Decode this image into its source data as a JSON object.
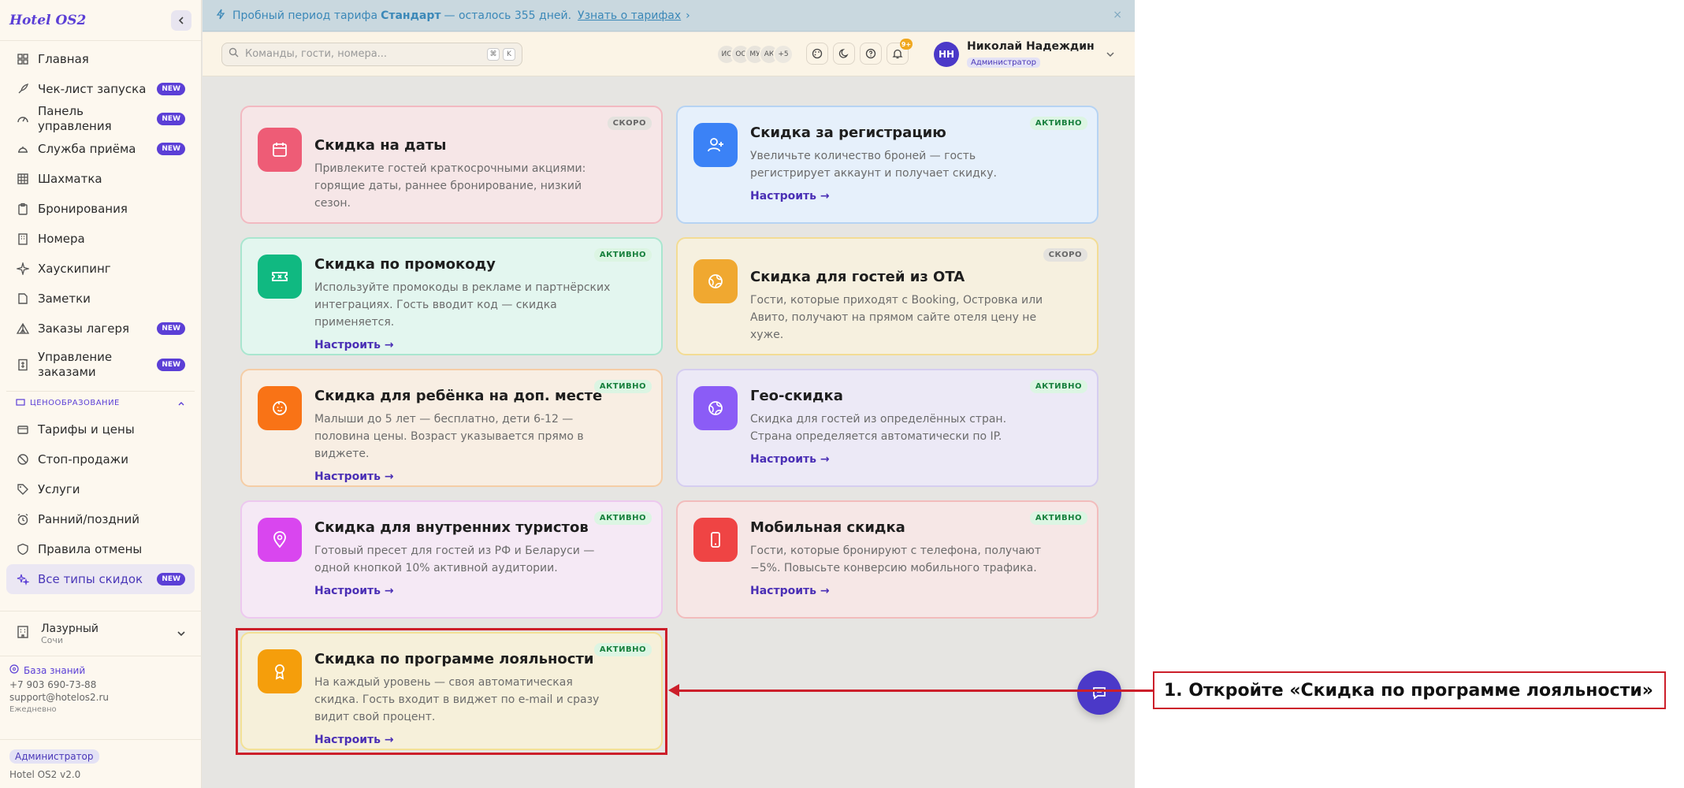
{
  "app": {
    "logo": "Hotel OS2"
  },
  "sidebar": {
    "items": [
      {
        "label": "Главная",
        "icon": "grid-icon"
      },
      {
        "label": "Чек-лист запуска",
        "icon": "rocket-icon",
        "badge": "NEW"
      },
      {
        "label": "Панель управления",
        "icon": "gauge-icon",
        "badge": "NEW"
      },
      {
        "label": "Служба приёма",
        "icon": "bell-desk-icon",
        "badge": "NEW"
      },
      {
        "label": "Шахматка",
        "icon": "table-icon"
      },
      {
        "label": "Бронирования",
        "icon": "clipboard-icon"
      },
      {
        "label": "Номера",
        "icon": "building-icon"
      },
      {
        "label": "Хаускипинг",
        "icon": "sparkle-icon"
      },
      {
        "label": "Заметки",
        "icon": "note-icon"
      },
      {
        "label": "Заказы лагеря",
        "icon": "tent-icon",
        "badge": "NEW"
      },
      {
        "label": "Управление заказами",
        "icon": "receipt-icon",
        "badge": "NEW"
      }
    ],
    "pricing_section": "ЦЕНООБРАЗОВАНИЕ",
    "pricing_items": [
      {
        "label": "Тарифы и цены",
        "icon": "wallet-icon"
      },
      {
        "label": "Стоп-продажи",
        "icon": "ban-icon"
      },
      {
        "label": "Услуги",
        "icon": "tag-icon"
      },
      {
        "label": "Ранний/поздний",
        "icon": "alarm-icon"
      },
      {
        "label": "Правила отмены",
        "icon": "shield-icon"
      },
      {
        "label": "Все типы скидок",
        "icon": "sparkles-icon",
        "badge": "NEW",
        "active": true
      }
    ],
    "hotel": {
      "name": "Лазурный",
      "city": "Сочи"
    },
    "footer": {
      "kb_label": "База знаний",
      "phone": "+7 903 690-73-88",
      "email": "support@hotelos2.ru",
      "hours": "Ежедневно",
      "role": "Администратор",
      "version": "Hotel OS2 v2.0"
    }
  },
  "banner": {
    "text_before": "Пробный период тарифа",
    "plan": "Стандарт",
    "text_after": "— осталось 355 дней.",
    "link": "Узнать о тарифах",
    "chevron": "›",
    "close": "×"
  },
  "header": {
    "search_placeholder": "Команды, гости, номера...",
    "kbd1": "⌘",
    "kbd2": "K",
    "avatars": [
      "ИС",
      "ОС",
      "МУ",
      "АК",
      "+5"
    ],
    "notif_count": "9+",
    "user_initials": "НН",
    "user_name": "Николай Надеждин",
    "user_role": "Администратор"
  },
  "cards": [
    {
      "title": "Скидка на даты",
      "desc": "Привлеките гостей краткосрочными акциями: горящие даты, раннее бронирование, низкий сезон.",
      "status": "СКОРО",
      "link": "",
      "icon": "calendar-icon",
      "bg": "#f6e6e7",
      "border": "#f2b9c1",
      "icon_bg": "#ee5c76"
    },
    {
      "title": "Скидка за регистрацию",
      "desc": "Увеличьте количество броней — гость регистрирует аккаунт и получает скидку.",
      "status": "АКТИВНО",
      "link": "Настроить →",
      "icon": "user-plus-icon",
      "bg": "#e6f0fb",
      "border": "#b6d3f3",
      "icon_bg": "#3b82f6"
    },
    {
      "title": "Скидка по промокоду",
      "desc": "Используйте промокоды в рекламе и партнёрских интеграциях. Гость вводит код — скидка применяется.",
      "status": "АКТИВНО",
      "link": "Настроить →",
      "icon": "ticket-icon",
      "bg": "#e3f6ef",
      "border": "#a9e6cf",
      "icon_bg": "#10b981"
    },
    {
      "title": "Скидка для гостей из OTA",
      "desc": "Гости, которые приходят с Booking, Островка или Авито, получают на прямом сайте отеля цену не хуже.",
      "status": "СКОРО",
      "link": "",
      "icon": "globe-icon",
      "bg": "#f6f0df",
      "border": "#f3dc94",
      "icon_bg": "#f0a830"
    },
    {
      "title": "Скидка для ребёнка на доп. месте",
      "desc": "Малыши до 5 лет — бесплатно, дети 6-12 — половина цены. Возраст указывается прямо в виджете.",
      "status": "АКТИВНО",
      "link": "Настроить →",
      "icon": "baby-icon",
      "bg": "#f8eee3",
      "border": "#f5cda6",
      "icon_bg": "#f97316"
    },
    {
      "title": "Гео-скидка",
      "desc": "Скидка для гостей из определённых стран. Страна определяется автоматически по IP.",
      "status": "АКТИВНО",
      "link": "Настроить →",
      "icon": "globe-icon",
      "bg": "#ece9f6",
      "border": "#d5cdf0",
      "icon_bg": "#8b5cf6"
    },
    {
      "title": "Скидка для внутренних туристов",
      "desc": "Готовый пресет для гостей из РФ и Беларуси — одной кнопкой 10% активной аудитории.",
      "status": "АКТИВНО",
      "link": "Настроить →",
      "icon": "map-pin-icon",
      "bg": "#f5e9f5",
      "border": "#edc8ef",
      "icon_bg": "#d946ef"
    },
    {
      "title": "Мобильная скидка",
      "desc": "Гости, которые бронируют с телефона, получают −5%. Повысьте конверсию мобильного трафика.",
      "status": "АКТИВНО",
      "link": "Настроить →",
      "icon": "smartphone-icon",
      "bg": "#f6e7e6",
      "border": "#f2bcbc",
      "icon_bg": "#ef4444"
    },
    {
      "title": "Скидка по программе лояльности",
      "desc": "На каждый уровень — своя автоматическая скидка. Гость входит в виджет по e-mail и сразу видит свой процент.",
      "status": "АКТИВНО",
      "link": "Настроить →",
      "icon": "award-icon",
      "bg": "#f6f0da",
      "border": "#f3e196",
      "icon_bg": "#f59e0b"
    }
  ],
  "annotation": {
    "text": "1. Откройте «Скидка по программе лояльности»",
    "color": "#cc1f2a"
  }
}
